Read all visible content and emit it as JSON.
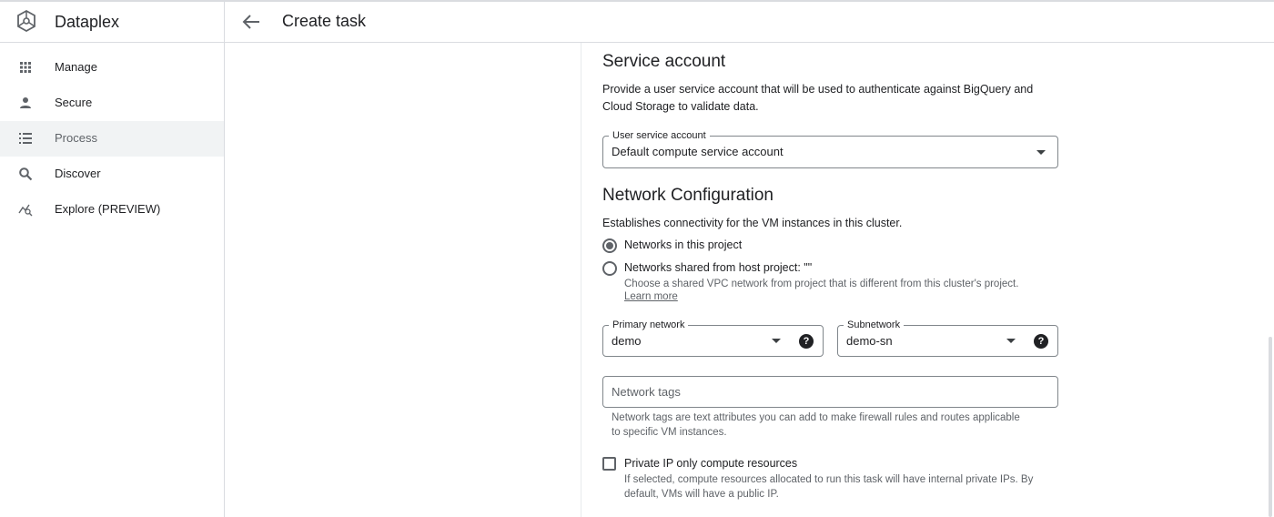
{
  "app": {
    "name": "Dataplex"
  },
  "sidebar": {
    "items": [
      {
        "label": "Manage",
        "icon": "grid-icon"
      },
      {
        "label": "Secure",
        "icon": "person-icon"
      },
      {
        "label": "Process",
        "icon": "list-icon",
        "active": true
      },
      {
        "label": "Discover",
        "icon": "search-icon"
      },
      {
        "label": "Explore (PREVIEW)",
        "icon": "explore-icon"
      }
    ]
  },
  "header": {
    "title": "Create task",
    "back_icon": "arrow-back-icon"
  },
  "service_account": {
    "title": "Service account",
    "description_line1": "Provide a user service account that will be used to authenticate against BigQuery and",
    "description_line2": "Cloud Storage to validate data.",
    "field_label": "User service account",
    "field_value": "Default compute service account"
  },
  "network": {
    "title": "Network Configuration",
    "description": "Establishes connectivity for the VM instances in this cluster.",
    "option_project": "Networks in this project",
    "option_shared": "Networks shared from host project: \"\"",
    "shared_helper": "Choose a shared VPC network from project that is different from this cluster's project.",
    "learn_more": "Learn more",
    "primary_label": "Primary network",
    "primary_value": "demo",
    "subnet_label": "Subnetwork",
    "subnet_value": "demo-sn",
    "tags_placeholder": "Network tags",
    "tags_helper_line1": "Network tags are text attributes you can add to make firewall rules and routes applicable",
    "tags_helper_line2": "to specific VM instances.",
    "private_ip_label": "Private IP only compute resources",
    "private_ip_helper_line1": "If selected, compute resources allocated to run this task will have internal private IPs. By",
    "private_ip_helper_line2": "default, VMs will have a public IP.",
    "selected_option": "Networks in this project",
    "private_ip_checked": false
  },
  "colors": {
    "text": "#202124",
    "secondary": "#5f6368",
    "border": "#80868b",
    "active_bg": "#f1f3f4"
  }
}
